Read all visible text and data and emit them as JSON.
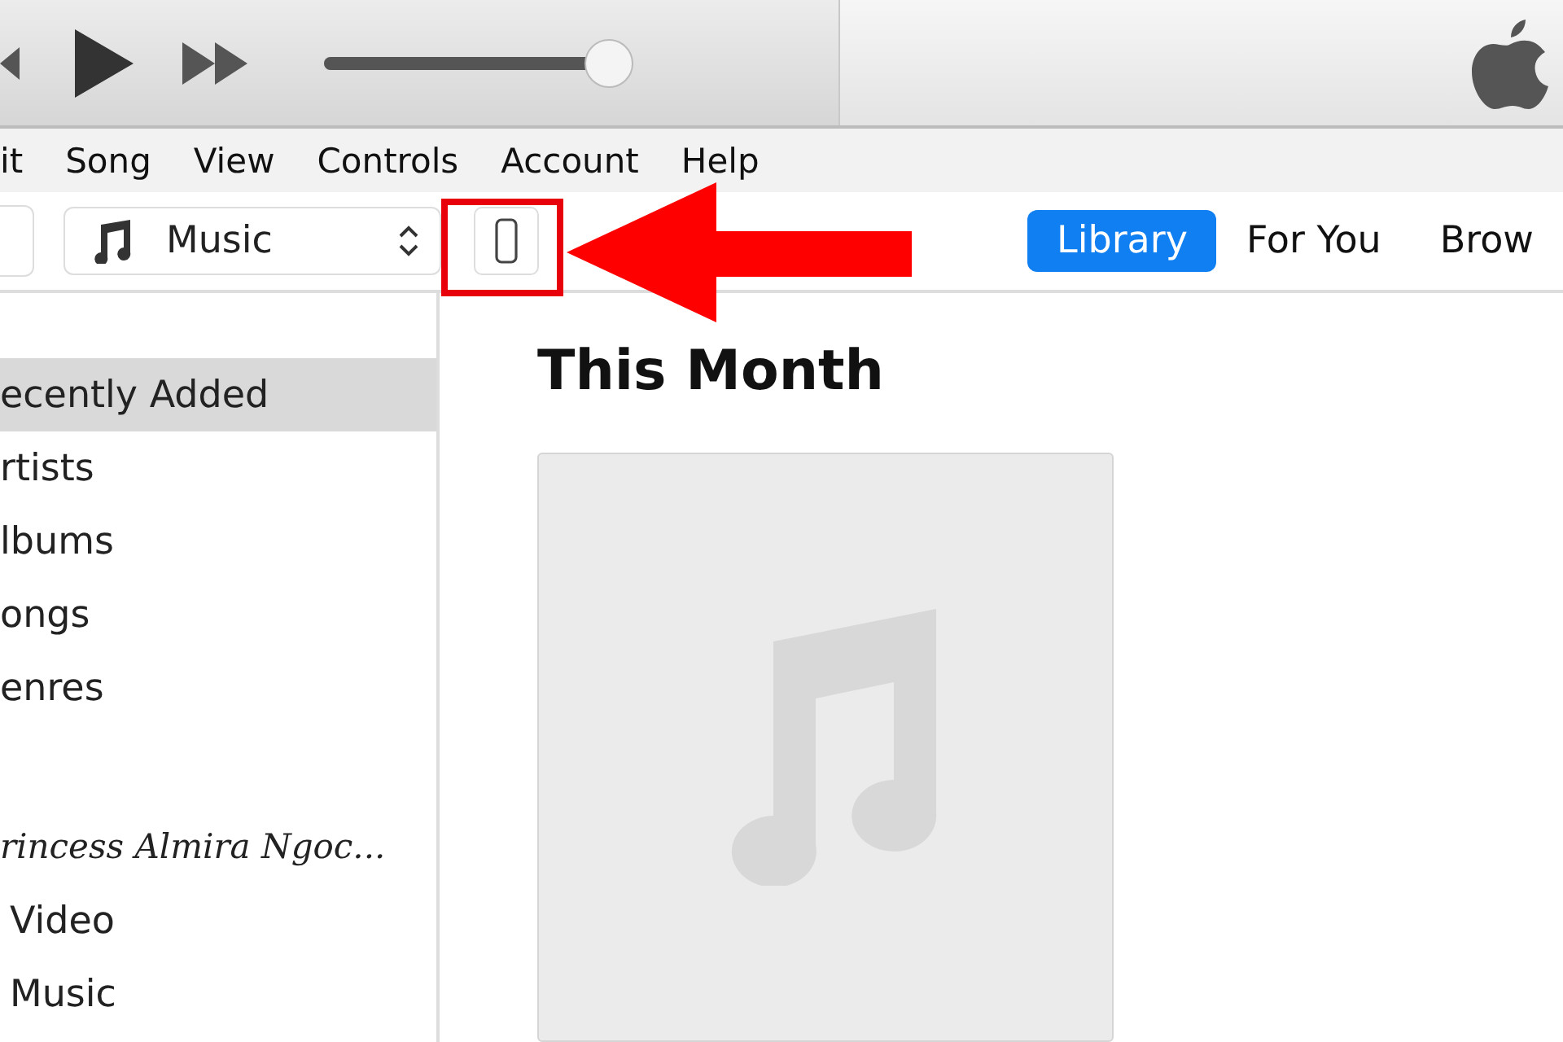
{
  "player": {
    "volume": {
      "level": 0.92
    }
  },
  "menu": [
    "it",
    "Song",
    "View",
    "Controls",
    "Account",
    "Help"
  ],
  "toolbar": {
    "media_picker": {
      "label": "Music"
    },
    "tabs": [
      {
        "label": "Library",
        "selected": true
      },
      {
        "label": "For You",
        "selected": false
      },
      {
        "label": "Brow",
        "selected": false
      }
    ]
  },
  "sidebar": {
    "library_items": [
      {
        "label": "ecently Added",
        "selected": true
      },
      {
        "label": "rtists",
        "selected": false
      },
      {
        "label": "lbums",
        "selected": false
      },
      {
        "label": "ongs",
        "selected": false
      },
      {
        "label": "enres",
        "selected": false
      }
    ],
    "device": {
      "name": "rincess Almira Ngoc...",
      "items": [
        {
          "label": "Video",
          "selected": false
        },
        {
          "label": "Music",
          "selected": false
        }
      ]
    }
  },
  "content": {
    "heading": "This Month",
    "albums": [
      {
        "kind": "placeholder"
      }
    ]
  }
}
